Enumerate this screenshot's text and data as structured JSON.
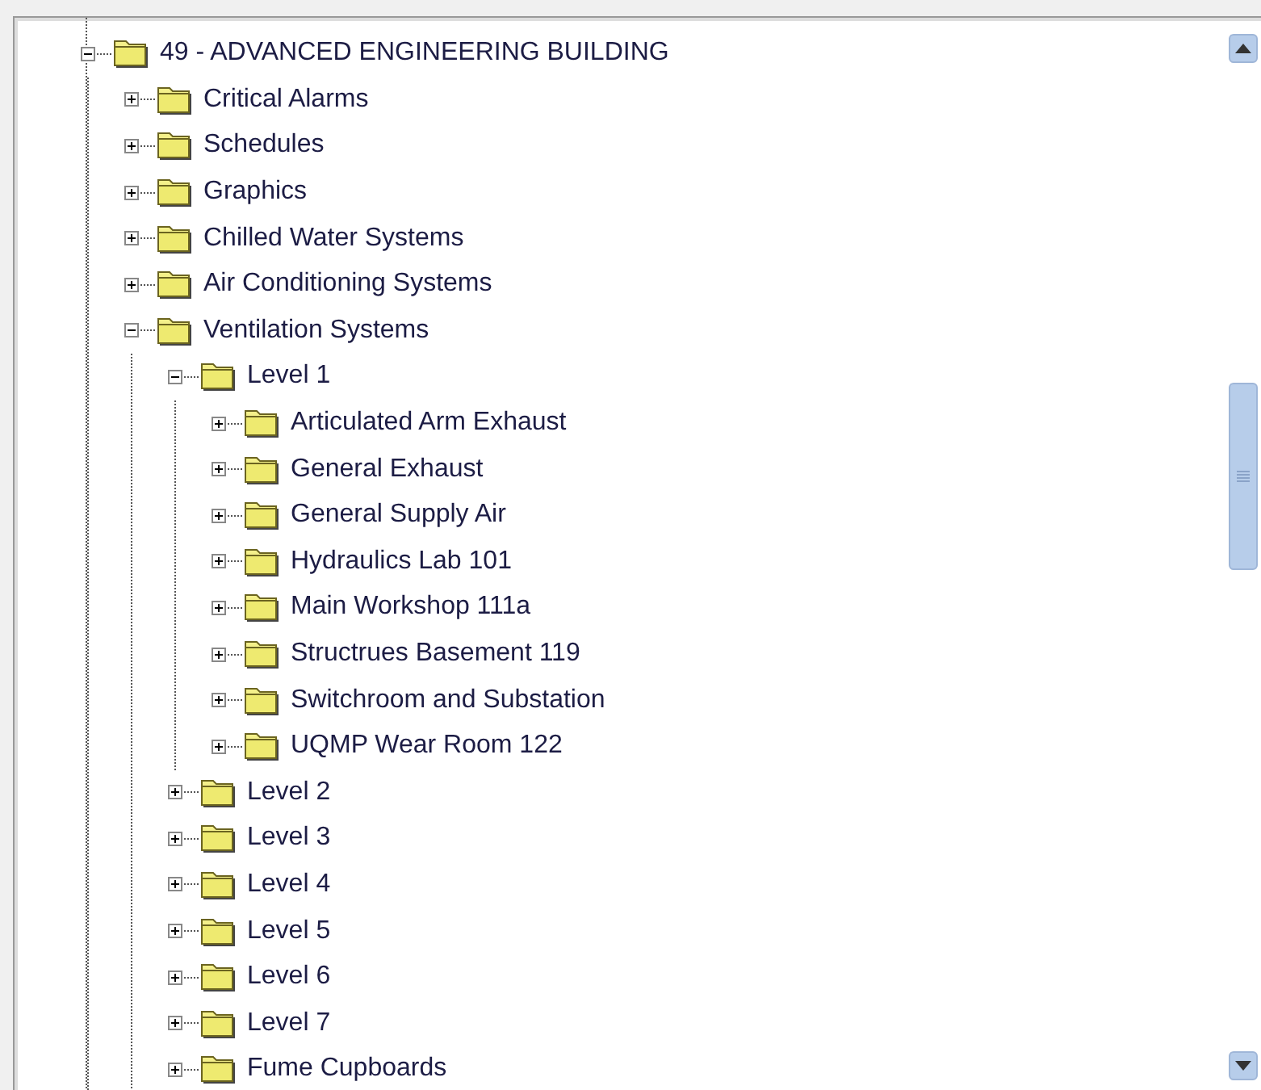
{
  "tree": {
    "label": "49 - ADVANCED ENGINEERING BUILDING",
    "expanded": true,
    "children": [
      {
        "label": "Critical Alarms",
        "expanded": false
      },
      {
        "label": "Schedules",
        "expanded": false
      },
      {
        "label": "Graphics",
        "expanded": false
      },
      {
        "label": "Chilled Water Systems",
        "expanded": false
      },
      {
        "label": "Air Conditioning Systems",
        "expanded": false
      },
      {
        "label": "Ventilation Systems",
        "expanded": true,
        "children": [
          {
            "label": "Level 1",
            "expanded": true,
            "children": [
              {
                "label": "Articulated Arm Exhaust",
                "expanded": false
              },
              {
                "label": "General Exhaust",
                "expanded": false
              },
              {
                "label": "General Supply Air",
                "expanded": false
              },
              {
                "label": "Hydraulics Lab 101",
                "expanded": false
              },
              {
                "label": "Main Workshop 111a",
                "expanded": false
              },
              {
                "label": "Structrues Basement 119",
                "expanded": false
              },
              {
                "label": "Switchroom and Substation",
                "expanded": false
              },
              {
                "label": "UQMP Wear Room 122",
                "expanded": false
              }
            ]
          },
          {
            "label": "Level 2",
            "expanded": false
          },
          {
            "label": "Level 3",
            "expanded": false
          },
          {
            "label": "Level 4",
            "expanded": false
          },
          {
            "label": "Level 5",
            "expanded": false
          },
          {
            "label": "Level 6",
            "expanded": false
          },
          {
            "label": "Level 7",
            "expanded": false
          },
          {
            "label": "Fume Cupboards",
            "expanded": false
          }
        ]
      }
    ]
  }
}
